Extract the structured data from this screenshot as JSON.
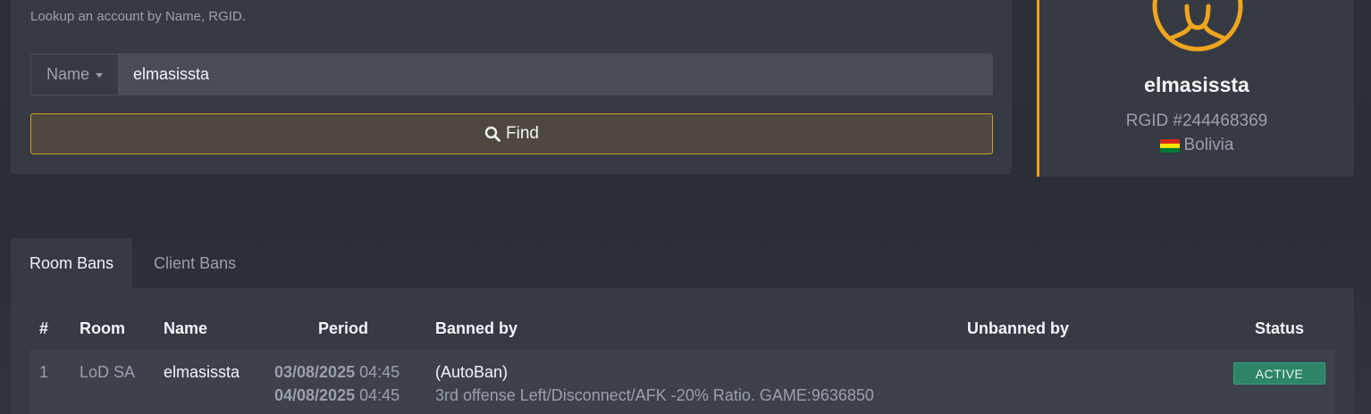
{
  "search": {
    "hint": "Lookup an account by Name, RGID.",
    "mode_label": "Name",
    "value": "elmasissta",
    "find_label": "Find"
  },
  "profile": {
    "name": "elmasissta",
    "rgid": "RGID #244468369",
    "country": "Bolivia",
    "accent_color": "#f0a51e"
  },
  "tabs": [
    {
      "label": "Room Bans",
      "active": true
    },
    {
      "label": "Client Bans",
      "active": false
    }
  ],
  "table": {
    "headers": {
      "num": "#",
      "room": "Room",
      "name": "Name",
      "period": "Period",
      "banned_by": "Banned by",
      "unbanned_by": "Unbanned by",
      "status": "Status"
    },
    "rows": [
      {
        "num": "1",
        "room": "LoD SA",
        "name": "elmasissta",
        "start_date": "03/08/2025",
        "start_time": "04:45",
        "end_date": "04/08/2025",
        "end_time": "04:45",
        "banned_by": "(AutoBan)",
        "reason": "3rd offense Left/Disconnect/AFK -20% Ratio. GAME:9636850",
        "unbanned_by": "",
        "status": "ACTIVE",
        "status_color": "#2e8467"
      }
    ]
  }
}
